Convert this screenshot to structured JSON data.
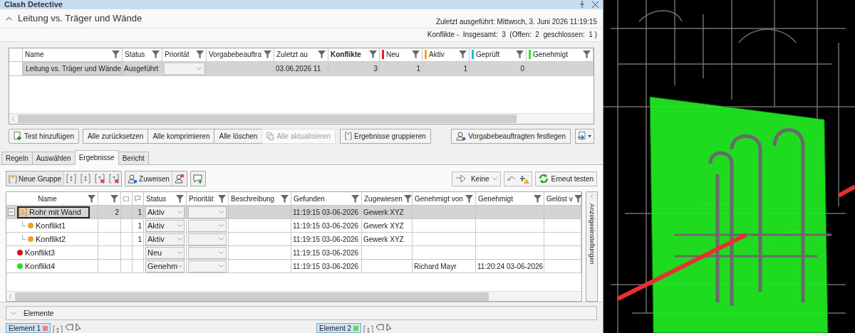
{
  "window": {
    "title": "Clash Detective"
  },
  "test": {
    "name": "Leitung vs. Träger und Wände",
    "expanded": true,
    "last_run": "Zuletzt ausgeführt:  Mittwoch, 3. Juni 2026 11:19:15",
    "summary": "Konflikte -  Insgesamt:  3  (Offen:  2  geschlossen:  1 )"
  },
  "tests_table": {
    "columns": [
      {
        "label": "Name",
        "bold": false
      },
      {
        "label": "Status",
        "bold": false
      },
      {
        "label": "Priorität",
        "bold": false
      },
      {
        "label": "Vorgabebeauftra",
        "bold": false
      },
      {
        "label": "Zuletzt au",
        "bold": false
      },
      {
        "label": "Konflikte",
        "bold": true
      },
      {
        "label": "Neu",
        "bold": false,
        "color": "#e8202a"
      },
      {
        "label": "Aktiv",
        "bold": false,
        "color": "#f5a623"
      },
      {
        "label": "Geprüft",
        "bold": false,
        "color": "#29b6e8"
      },
      {
        "label": "Genehmigt",
        "bold": false,
        "color": "#2ee82e"
      }
    ],
    "rows": [
      {
        "selected": true,
        "name": "Leitung vs. Träger und Wände",
        "status": "Ausgeführt",
        "last_run": "03.06.2026 11",
        "conflicts": "3",
        "new": "1",
        "active": "1",
        "reviewed": "0"
      }
    ]
  },
  "buttons": {
    "add_test": "Test hinzufügen",
    "bulk": [
      {
        "label": "Alle zurücksetzen",
        "disabled": false
      },
      {
        "label": "Alle komprimieren",
        "disabled": false
      },
      {
        "label": "Alle löschen",
        "disabled": false
      },
      {
        "label": "Alle aktualisieren",
        "disabled": true
      }
    ],
    "group_results": "Ergebnisse gruppieren",
    "set_assignee": "Vorgabebeauftragten festlegen"
  },
  "tabs": [
    {
      "label": "Regeln",
      "selected": false
    },
    {
      "label": "Auswählen",
      "selected": false
    },
    {
      "label": "Ergebnisse",
      "selected": true
    },
    {
      "label": "Bericht",
      "selected": false
    }
  ],
  "results_toolbar": {
    "new_group": "Neue Gruppe",
    "assign": "Zuweisen",
    "filter": "Keine",
    "retest": "Erneut testen"
  },
  "results_table": {
    "columns": [
      {
        "kind": "text",
        "label": "Name"
      },
      {
        "kind": "filter"
      },
      {
        "kind": "image"
      },
      {
        "kind": "comment"
      },
      {
        "kind": "text",
        "label": "Status"
      },
      {
        "kind": "text",
        "label": "Priorität"
      },
      {
        "kind": "text",
        "label": "Beschreibung"
      },
      {
        "kind": "text",
        "label": "Gefunden"
      },
      {
        "kind": "text",
        "label": "Zugewiesen"
      },
      {
        "kind": "text",
        "label": "Genehmigt von"
      },
      {
        "kind": "text",
        "label": "Genehmigt"
      },
      {
        "kind": "text",
        "label": "Gelöst v"
      }
    ],
    "rows": [
      {
        "kind": "group",
        "name": "Rohr mit Wand",
        "expanded": true,
        "selected": true,
        "count": "2",
        "comments": "1",
        "status": "Aktiv",
        "found": "11:19:15 03-06-2026",
        "assigned": "Gewerk XYZ",
        "children": [
          {
            "kind": "conflict",
            "name": "Konflikt1",
            "color": "#f0a020",
            "selected": false,
            "comments": "1",
            "status": "Aktiv",
            "found": "11:19:15 03-06-2026",
            "assigned": "Gewerk XYZ"
          },
          {
            "kind": "conflict",
            "name": "Konflikt2",
            "color": "#f0a020",
            "selected": false,
            "comments": "1",
            "status": "Aktiv",
            "found": "11:19:15 03-06-2026",
            "assigned": "Gewerk XYZ"
          }
        ]
      },
      {
        "kind": "conflict",
        "name": "Konflikt3",
        "color": "#e01010",
        "selected": false,
        "status": "Neu",
        "found": "11:19:15 03-06-2026"
      },
      {
        "kind": "conflict",
        "name": "Konflikt4",
        "color": "#22dd22",
        "selected": false,
        "status": "Genehm",
        "found": "11:19:15 03-06-2026",
        "approved_by": "Richard Mayr",
        "approved": "11:20:24 03-06-2026"
      }
    ]
  },
  "side_panel": {
    "label": "Anzeigeeinstellungen"
  },
  "elements_section": {
    "label": "Elemente",
    "expanded": false
  },
  "element_tabs": [
    {
      "label": "Element 1",
      "color": "#f08080"
    },
    {
      "label": "Element 2",
      "color": "#66dd44"
    }
  ]
}
